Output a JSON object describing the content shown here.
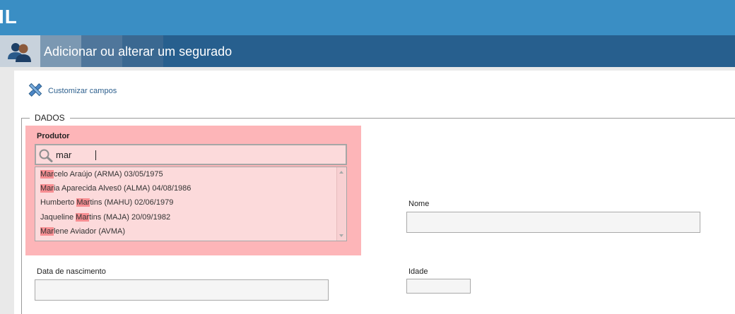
{
  "header": {
    "logo_text": "IL"
  },
  "titlebar": {
    "title": "Adicionar ou alterar um segurado"
  },
  "toolbar": {
    "customize_label": "Customizar campos"
  },
  "form": {
    "legend": "DADOS",
    "produtor": {
      "label": "Produtor",
      "search_value": "mar",
      "suggestions": [
        {
          "match": "Mar",
          "rest": "celo Araújo (ARMA) 03/05/1975"
        },
        {
          "match": "Mar",
          "rest": "ia Aparecida Alves0 (ALMA) 04/08/1986"
        },
        {
          "prefix": "Humberto ",
          "match": "Mar",
          "rest": "tins (MAHU) 02/06/1979"
        },
        {
          "prefix": "Jaqueline ",
          "match": "Mar",
          "rest": "tins (MAJA) 20/09/1982"
        },
        {
          "match": "Mar",
          "rest": "lene Aviador (AVMA)"
        }
      ]
    },
    "nome": {
      "label": "Nome",
      "value": ""
    },
    "data_nascimento": {
      "label": "Data de nascimento",
      "value": ""
    },
    "idade": {
      "label": "Idade",
      "value": ""
    }
  },
  "colors": {
    "header_blue": "#3a8ec4",
    "titlebar_blue": "#275f8e",
    "highlight_pink": "#fdb5b8",
    "match_highlight": "#f78e92"
  }
}
